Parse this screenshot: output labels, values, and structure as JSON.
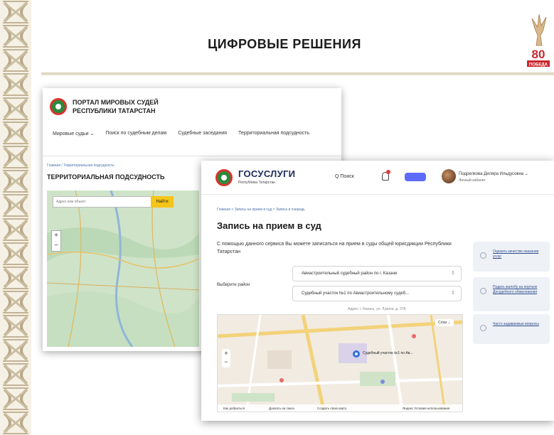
{
  "slide": {
    "title": "ЦИФРОВЫЕ РЕШЕНИЯ",
    "logo_text": "80 ПОБЕДА"
  },
  "back_window": {
    "portal_title_line1": "ПОРТАЛ МИРОВЫХ СУДЕЙ",
    "portal_title_line2": "РЕСПУБЛИКИ ТАТАРСТАН",
    "nav": [
      "Мировые судьи ⌄",
      "Поиск по судебным делам",
      "Судебные заседания",
      "Территориальная подсудность"
    ],
    "breadcrumb": "Главная  /  Территориальная подсудность",
    "page_title": "ТЕРРИТОРИАЛЬНАЯ ПОДСУДНОСТЬ",
    "search_placeholder": "Адрес или объект",
    "find_button": "Найти",
    "zoom_plus": "+",
    "zoom_minus": "−"
  },
  "front_window": {
    "brand": "ГОСУСЛУГИ",
    "brand_sub": "Республика Татарстан",
    "search_label": "Q  Поиск",
    "user_name": "Подрелкова Диляра Ильдусовна ⌄",
    "user_cabinet": "Личный кабинет",
    "breadcrumb": "Главная   >   Запись на прием в суд   >   Запись в очередь",
    "page_title": "Запись на прием в суд",
    "description": "С помощью данного сервиса Вы можете записаться на прием в суды общей юрисдикции Республики Татарстан",
    "district_label": "Выберите район",
    "select_district": "Авиастроительный судебный район по г. Казани",
    "select_section": "Судебный участок №1 по Авиастроительному судеб...",
    "address": "Адрес: г. Казань, ул. Лукина, д. 37Б",
    "map_marker_label": "Судебный участок №1 по Ав...",
    "map_layers": "Слои ⌄",
    "map_footer": [
      "Как добраться",
      "Доехать на такси",
      "Создать свою карту",
      "Яндекс  Условия использования"
    ],
    "cards": [
      "Оценить качество оказания услуг",
      "Подать жалобу на портале Досудебного обжалования",
      "Часто задаваемые вопросы"
    ]
  }
}
